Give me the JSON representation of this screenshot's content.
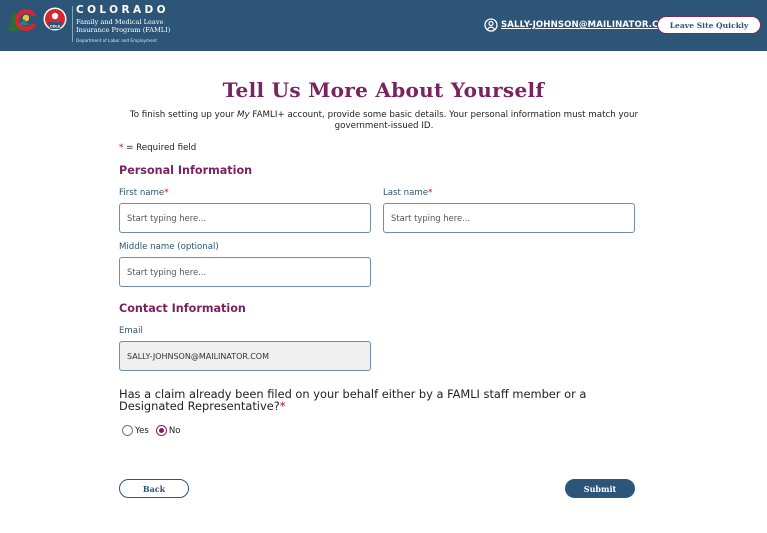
{
  "header": {
    "brand_state": "COLORADO",
    "brand_program": "Family and Medical Leave Insurance Program (FAMLI)",
    "brand_department": "Department of Labor and Employment",
    "logo_badge_text": "CDLE",
    "user_email": "SALLY-JOHNSON@MAILINATOR.COM",
    "leave_site_label": "Leave Site Quickly"
  },
  "colors": {
    "header_bg": "#2c5577",
    "accent_plum": "#7a2360",
    "required_red": "#d0021b"
  },
  "page": {
    "title": "Tell Us More About Yourself",
    "intro_before": "To finish setting up your ",
    "intro_em": "My",
    "intro_after": " FAMLI+ account, provide some basic details. Your personal information must match your government-issued ID.",
    "required_star": "*",
    "required_note": " = Required field"
  },
  "personal": {
    "section_title": "Personal Information",
    "first_name": {
      "label": "First name",
      "required": "*",
      "placeholder": "Start typing here...",
      "value": ""
    },
    "last_name": {
      "label": "Last name",
      "required": "*",
      "placeholder": "Start typing here...",
      "value": ""
    },
    "middle_name": {
      "label": "Middle name (optional)",
      "placeholder": "Start typing here...",
      "value": ""
    }
  },
  "contact": {
    "section_title": "Contact Information",
    "email": {
      "label": "Email",
      "value": "SALLY-JOHNSON@MAILINATOR.COM"
    }
  },
  "claim_question": {
    "text": "Has a claim already been filed on your behalf either by a FAMLI staff member or a Designated Representative?",
    "required": "*",
    "options": [
      {
        "label": "Yes",
        "checked": false
      },
      {
        "label": "No",
        "checked": true
      }
    ]
  },
  "actions": {
    "back_label": "Back",
    "submit_label": "Submit"
  }
}
